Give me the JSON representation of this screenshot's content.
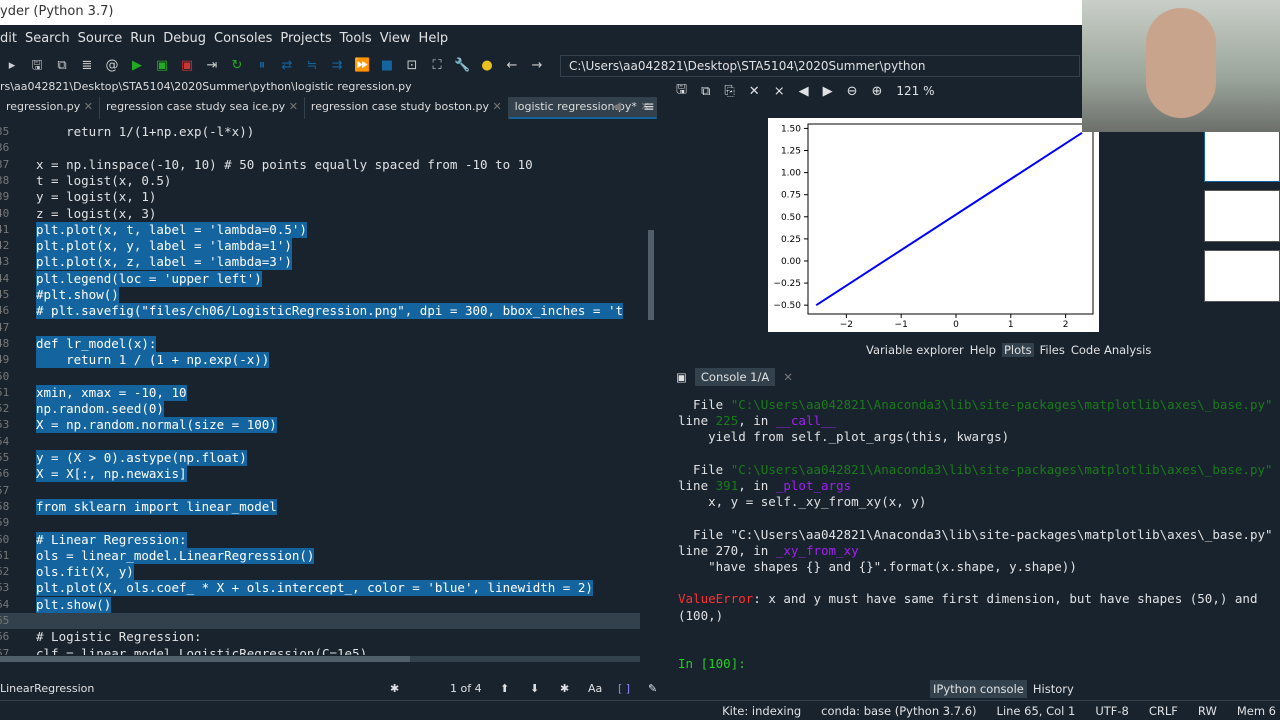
{
  "window": {
    "title": "yder (Python 3.7)"
  },
  "menu": [
    "dit",
    "Search",
    "Source",
    "Run",
    "Debug",
    "Consoles",
    "Projects",
    "Tools",
    "View",
    "Help"
  ],
  "toolbar": {
    "path": "C:\\Users\\aa042821\\Desktop\\STA5104\\2020Summer\\python"
  },
  "editor": {
    "file_path": "rs\\aa042821\\Desktop\\STA5104\\2020Summer\\python\\logistic regression.py",
    "tabs": [
      {
        "label": "regression.py"
      },
      {
        "label": "regression case study sea ice.py"
      },
      {
        "label": "regression case study boston.py"
      },
      {
        "label": "logistic regression.py*",
        "active": true
      }
    ],
    "lines": [
      {
        "n": "35",
        "code": "    return 1/(1+np.exp(-l*x))"
      },
      {
        "n": "36",
        "code": ""
      },
      {
        "n": "37",
        "code": "x = np.linspace(-10, 10) # 50 points equally spaced from -10 to 10"
      },
      {
        "n": "38",
        "code": "t = logist(x, 0.5)"
      },
      {
        "n": "39",
        "code": "y = logist(x, 1)"
      },
      {
        "n": "40",
        "code": "z = logist(x, 3)"
      },
      {
        "n": "41",
        "code": "plt.plot(x, t, label = 'lambda=0.5')",
        "sel": true
      },
      {
        "n": "42",
        "code": "plt.plot(x, y, label = 'lambda=1')",
        "sel": true
      },
      {
        "n": "43",
        "code": "plt.plot(x, z, label = 'lambda=3')",
        "sel": true
      },
      {
        "n": "44",
        "code": "plt.legend(loc = 'upper left')",
        "sel": true
      },
      {
        "n": "45",
        "code": "#plt.show()",
        "sel": true
      },
      {
        "n": "46",
        "code": "# plt.savefig(\"files/ch06/LogisticRegression.png\", dpi = 300, bbox_inches = 't",
        "sel": true
      },
      {
        "n": "47",
        "code": "",
        "sel": true
      },
      {
        "n": "48",
        "code": "def lr_model(x):",
        "sel": true
      },
      {
        "n": "49",
        "code": "    return 1 / (1 + np.exp(-x))",
        "sel": true
      },
      {
        "n": "50",
        "code": "",
        "sel": true
      },
      {
        "n": "51",
        "code": "xmin, xmax = -10, 10",
        "sel": true
      },
      {
        "n": "52",
        "code": "np.random.seed(0)",
        "sel": true
      },
      {
        "n": "53",
        "code": "X = np.random.normal(size = 100)",
        "sel": true
      },
      {
        "n": "54",
        "code": "",
        "sel": true
      },
      {
        "n": "55",
        "code": "y = (X > 0).astype(np.float)",
        "sel": true
      },
      {
        "n": "56",
        "code": "X = X[:, np.newaxis]",
        "sel": true
      },
      {
        "n": "57",
        "code": "",
        "sel": true
      },
      {
        "n": "58",
        "code": "from sklearn import linear_model",
        "sel": true
      },
      {
        "n": "59",
        "code": "",
        "sel": true
      },
      {
        "n": "60",
        "code": "# Linear Regression:",
        "sel": true
      },
      {
        "n": "61",
        "code": "ols = linear_model.LinearRegression()",
        "sel": true
      },
      {
        "n": "62",
        "code": "ols.fit(X, y)",
        "sel": true
      },
      {
        "n": "63",
        "code": "plt.plot(X, ols.coef_ * X + ols.intercept_, color = 'blue', linewidth = 2)",
        "sel": true
      },
      {
        "n": "64",
        "code": "plt.show()",
        "sel": true
      },
      {
        "n": "65",
        "code": "",
        "cur": true
      },
      {
        "n": "66",
        "code": "# Logistic Regression:"
      },
      {
        "n": "67",
        "code": "clf = linear_model.LogisticRegression(C=1e5)"
      }
    ]
  },
  "find": {
    "value": "LinearRegression",
    "count": "1 of 4",
    "case": "Aa"
  },
  "plots": {
    "zoom": "121 %",
    "tabs": [
      "Variable explorer",
      "Help",
      "Plots",
      "Files",
      "Code Analysis"
    ],
    "active_tab": "Plots"
  },
  "chart_data": {
    "type": "line",
    "x_ticks": [
      "−2",
      "−1",
      "0",
      "1",
      "2"
    ],
    "y_ticks": [
      "1.50",
      "1.25",
      "1.00",
      "0.75",
      "0.50",
      "0.25",
      "0.00",
      "−0.25",
      "−0.50"
    ],
    "xlim": [
      -2.7,
      2.5
    ],
    "ylim": [
      -0.6,
      1.55
    ],
    "series": [
      {
        "color": "#0000ff",
        "x": [
          -2.55,
          2.3
        ],
        "y": [
          -0.5,
          1.45
        ]
      }
    ]
  },
  "console": {
    "tab": "Console 1/A",
    "lines": [
      {
        "parts": [
          [
            "  File ",
            ""
          ],
          [
            "\"C:\\Users\\aa042821\\Anaconda3\\lib\\site-packages\\matplotlib\\axes\\_base.py\"",
            "grn"
          ]
        ]
      },
      {
        "parts": [
          [
            "line ",
            ""
          ],
          [
            "225",
            "grn"
          ],
          [
            ", in ",
            ""
          ],
          [
            "__call__",
            "pur"
          ]
        ]
      },
      {
        "parts": [
          [
            "    yield from self._plot_args(this, kwargs)",
            ""
          ]
        ]
      },
      {
        "parts": [
          [
            "",
            ""
          ]
        ]
      },
      {
        "parts": [
          [
            "  File ",
            ""
          ],
          [
            "\"C:\\Users\\aa042821\\Anaconda3\\lib\\site-packages\\matplotlib\\axes\\_base.py\"",
            "grn"
          ]
        ]
      },
      {
        "parts": [
          [
            "line ",
            ""
          ],
          [
            "391",
            "grn"
          ],
          [
            ", in ",
            ""
          ],
          [
            "_plot_args",
            "pur"
          ]
        ]
      },
      {
        "parts": [
          [
            "    x, y = self._xy_from_xy(x, y)",
            ""
          ]
        ]
      },
      {
        "parts": [
          [
            "",
            ""
          ]
        ]
      },
      {
        "parts": [
          [
            "  File \"C:\\Users\\aa042821\\Anaconda3\\lib\\site-packages\\matplotlib\\axes\\_base.py\"",
            ""
          ]
        ]
      },
      {
        "parts": [
          [
            "line 270, in ",
            ""
          ],
          [
            "_xy_from_xy",
            "pur"
          ]
        ]
      },
      {
        "parts": [
          [
            "    \"have shapes {} and {}\".format(x.shape, y.shape))",
            ""
          ]
        ]
      },
      {
        "parts": [
          [
            "",
            ""
          ]
        ]
      },
      {
        "parts": [
          [
            "ValueError",
            "red"
          ],
          [
            ": x and y must have same first dimension, but have shapes (50,) and",
            ""
          ]
        ]
      },
      {
        "parts": [
          [
            "(100,)",
            ""
          ]
        ]
      },
      {
        "parts": [
          [
            "",
            ""
          ]
        ]
      },
      {
        "parts": [
          [
            "",
            ""
          ]
        ]
      },
      {
        "parts": [
          [
            "In [",
            "lgrn"
          ],
          [
            "100",
            "lgrn"
          ],
          [
            "]:",
            "lgrn"
          ]
        ]
      }
    ],
    "tabs": [
      "IPython console",
      "History"
    ]
  },
  "status": {
    "kite": "Kite: indexing",
    "conda": "conda: base (Python 3.7.6)",
    "position": "Line 65, Col 1",
    "encoding": "UTF-8",
    "eol": "CRLF",
    "perm": "RW",
    "mem": "Mem 6"
  }
}
